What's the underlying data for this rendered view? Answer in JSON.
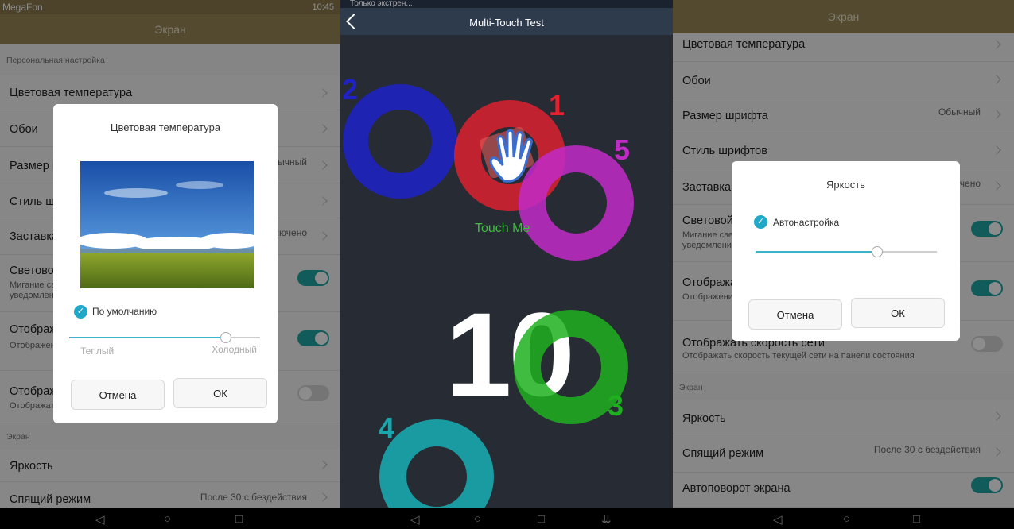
{
  "left_panel": {
    "status": {
      "carrier": "MegaFon",
      "time": "10:45"
    },
    "appbar_title": "Экран",
    "section_personal": "Персональная настройка",
    "rows": {
      "color_temp": "Цветовая температура",
      "wallpaper": "Обои",
      "font_size": "Размер шрифта",
      "font_size_value": "Обычный",
      "font_style": "Стиль шрифтов",
      "screensaver": "Заставка",
      "screensaver_value": "Включено",
      "led": "Световой индикатор",
      "led_sub": "Мигание светового индикатора при получении уведомлений",
      "show1": "Отображать",
      "show1_sub": "Отображение ... в строке состояния отображать",
      "show2": "Отображать",
      "show2_sub": "Отображать"
    },
    "section_screen": "Экран",
    "brightness": "Яркость",
    "sleep": "Спящий режим",
    "sleep_value": "После 30 с бездействия",
    "dialog": {
      "title": "Цветовая температура",
      "default_label": "По умолчанию",
      "warm": "Теплый",
      "cold": "Холодный",
      "slider_level": 0.82,
      "cancel": "Отмена",
      "ok": "ОК"
    }
  },
  "middle_panel": {
    "top_text": "Только экстрен...",
    "title": "Multi-Touch Test",
    "touch_me": "Touch Me",
    "touch_count": "10",
    "touch_labels": [
      "1",
      "2",
      "3",
      "4",
      "5"
    ],
    "colors": {
      "t1": "#e8202e",
      "t2": "#1e22c8",
      "t3": "#1fb01f",
      "t4": "#19a6ad",
      "t5": "#c22ac8"
    }
  },
  "right_panel": {
    "appbar_title": "Экран",
    "rows": {
      "color_temp": "Цветовая температура",
      "wallpaper": "Обои",
      "font_size": "Размер шрифта",
      "font_size_value": "Обычный",
      "font_style": "Стиль шрифтов",
      "screensaver": "Заставка",
      "screensaver_value": "Включено",
      "led": "Световой индикатор",
      "led_sub": "Мигание светового индикатора при получении уведомлений",
      "show1": "Отображать",
      "show1_sub": "Отображение ... отображать",
      "net_speed": "Отображать скорость сети",
      "net_speed_sub": "Отображать скорость текущей сети на панели состояния"
    },
    "section_screen": "Экран",
    "brightness": "Яркость",
    "sleep": "Спящий режим",
    "sleep_value": "После 30 с бездействия",
    "autorotate": "Автоповорот экрана",
    "dialog": {
      "title": "Яркость",
      "auto_label": "Автонастройка",
      "slider_level": 0.67,
      "cancel": "Отмена",
      "ok": "ОК"
    }
  }
}
